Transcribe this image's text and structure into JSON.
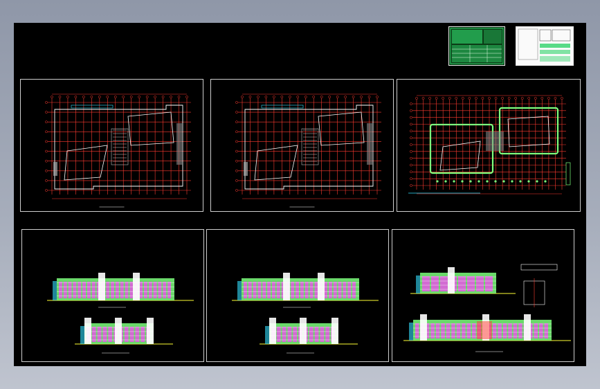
{
  "canvas": {
    "background": "#000000",
    "frame_color": "#cfcfcf"
  },
  "palette": {
    "grid": "#ff3b30",
    "wall": "#ffffff",
    "fill_green": "#7dff7d",
    "fill_magenta": "#ff3cff",
    "fill_yellow": "#ffff33",
    "cyan": "#33e0ff",
    "title_green": "#2fd36a"
  },
  "sheets": [
    {
      "id": "floor-plan-1",
      "kind": "floor-plan"
    },
    {
      "id": "floor-plan-2",
      "kind": "floor-plan"
    },
    {
      "id": "site-plan",
      "kind": "site-plan"
    },
    {
      "id": "elevation-1",
      "kind": "elevation"
    },
    {
      "id": "elevation-2",
      "kind": "elevation"
    },
    {
      "id": "sections",
      "kind": "section"
    }
  ],
  "title_blocks": [
    {
      "id": "title-block-green"
    },
    {
      "id": "title-block-white"
    }
  ]
}
